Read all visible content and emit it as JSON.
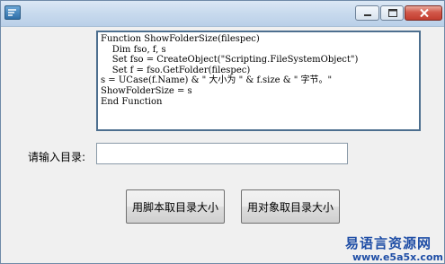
{
  "window": {
    "title_icon": "app-icon",
    "controls": [
      "minimize-icon",
      "maximize-icon",
      "close-icon"
    ]
  },
  "code": {
    "text": "Function ShowFolderSize(filespec)\n    Dim fso, f, s\n    Set fso = CreateObject(\"Scripting.FileSystemObject\")\n    Set f = fso.GetFolder(filespec)\ns = UCase(f.Name) & \" 大小为 \" & f.size & \" 字节。\"\nShowFolderSize = s\nEnd Function"
  },
  "form": {
    "dir_label": "请输入目录:",
    "dir_value": ""
  },
  "buttons": {
    "script_label": "用脚本取目录大小",
    "object_label": "用对象取目录大小"
  },
  "watermark": {
    "cn": "易语言资源网",
    "url": "www.e5a5x.com"
  },
  "colors": {
    "accent": "#1f4ea6",
    "close": "#c23d2f"
  }
}
